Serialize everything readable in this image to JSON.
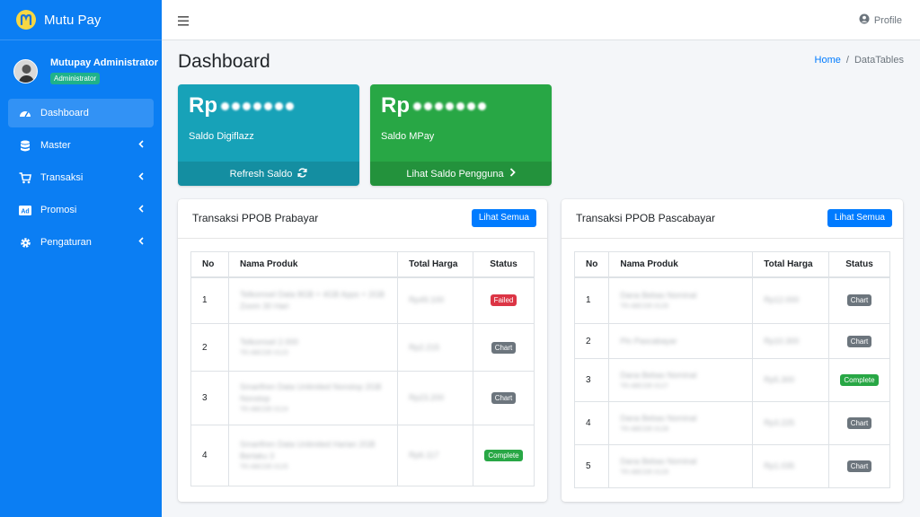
{
  "brand": {
    "name": "Mutu Pay"
  },
  "user": {
    "name": "Mutupay Administrator",
    "role": "Administrator"
  },
  "sidebar": {
    "items": [
      {
        "label": "Dashboard",
        "icon": "dashboard-icon"
      },
      {
        "label": "Master",
        "icon": "database-icon"
      },
      {
        "label": "Transaksi",
        "icon": "cart-icon"
      },
      {
        "label": "Promosi",
        "icon": "ad-icon"
      },
      {
        "label": "Pengaturan",
        "icon": "gear-icon"
      }
    ]
  },
  "topbar": {
    "profile": "Profile"
  },
  "header": {
    "title": "Dashboard",
    "breadcrumb": {
      "home": "Home",
      "separator": "/",
      "current": "DataTables"
    }
  },
  "boxes": [
    {
      "currency": "Rp",
      "label": "Saldo Digiflazz",
      "footer": "Refresh Saldo",
      "color": "#17a2b8"
    },
    {
      "currency": "Rp",
      "label": "Saldo MPay",
      "footer": "Lihat Saldo Pengguna",
      "color": "#28a745"
    }
  ],
  "prabayar": {
    "title": "Transaksi PPOB Prabayar",
    "button": "Lihat Semua",
    "columns": [
      "No",
      "Nama Produk",
      "Total Harga",
      "Status"
    ],
    "rows": [
      {
        "no": "1",
        "produk": "Telkomsel Data 8GB + 4GB Apps + 2GB Zoom 30 Hari",
        "sub": "",
        "harga": "Rp49.100",
        "status": "Failed"
      },
      {
        "no": "2",
        "produk": "Telkomsel 2.000",
        "sub": "TR-ABCDE-0123",
        "harga": "Rp2.215",
        "status": "Chart"
      },
      {
        "no": "3",
        "produk": "Smartfren Data Unlimited Nonstop 2GB Nonstop",
        "sub": "TR-ABCDE-0124",
        "harga": "Rp23.200",
        "status": "Chart"
      },
      {
        "no": "4",
        "produk": "Smartfren Data Unlimited Harian 2GB Berlaku 3",
        "sub": "TR-ABCDE-0125",
        "harga": "Rp6.117",
        "status": "Complete"
      }
    ]
  },
  "pascabayar": {
    "title": "Transaksi PPOB Pascabayar",
    "button": "Lihat Semua",
    "columns": [
      "No",
      "Nama Produk",
      "Total Harga",
      "Status"
    ],
    "rows": [
      {
        "no": "1",
        "produk": "Dana Bebas Nominal",
        "sub": "TR-ABCDE-0126",
        "harga": "Rp12.000",
        "status": "Chart"
      },
      {
        "no": "2",
        "produk": "Pln Pascabayar",
        "sub": "",
        "harga": "Rp10.300",
        "status": "Chart"
      },
      {
        "no": "3",
        "produk": "Dana Bebas Nominal",
        "sub": "TR-ABCDE-0127",
        "harga": "Rp5.300",
        "status": "Complete"
      },
      {
        "no": "4",
        "produk": "Dana Bebas Nominal",
        "sub": "TR-ABCDE-0128",
        "harga": "Rp3.225",
        "status": "Chart"
      },
      {
        "no": "5",
        "produk": "Dana Bebas Nominal",
        "sub": "TR-ABCDE-0129",
        "harga": "Rp1.035",
        "status": "Chart"
      }
    ]
  }
}
